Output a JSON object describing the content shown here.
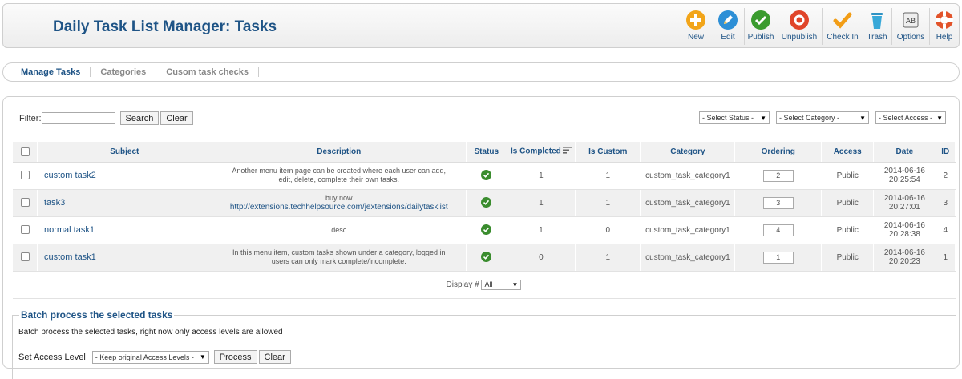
{
  "header": {
    "title": "Daily Task List Manager: Tasks",
    "toolbar": [
      {
        "label": "New",
        "icon": "plus-icon",
        "color": "#f2a51a"
      },
      {
        "label": "Edit",
        "icon": "pencil-icon",
        "color": "#2d8fd6"
      },
      {
        "label": "Publish",
        "icon": "check-icon",
        "color": "#3a9b2e"
      },
      {
        "label": "Unpublish",
        "icon": "circle-icon",
        "color": "#e0452a"
      },
      {
        "label": "Check In",
        "icon": "checkmark-icon",
        "color": "#f29d16"
      },
      {
        "label": "Trash",
        "icon": "trash-icon",
        "color": "#38a8d8"
      },
      {
        "label": "Options",
        "icon": "options-icon",
        "color": "#666666"
      },
      {
        "label": "Help",
        "icon": "lifebuoy-icon",
        "color": "#e2532a"
      }
    ]
  },
  "submenu": {
    "items": [
      "Manage Tasks",
      "Categories",
      "Cusom task checks"
    ],
    "active": 0
  },
  "filter": {
    "label": "Filter:",
    "value": "",
    "search_label": "Search",
    "clear_label": "Clear",
    "status_select": "- Select Status -",
    "category_select": "- Select Category -",
    "access_select": "- Select Access -"
  },
  "table": {
    "columns": [
      "Subject",
      "Description",
      "Status",
      "Is Completed",
      "Is Custom",
      "Category",
      "Ordering",
      "Access",
      "Date",
      "ID"
    ],
    "rows": [
      {
        "subject": "custom task2",
        "desc1": "Another menu item page can be created where each user can add,",
        "desc2": "edit, delete, complete their own tasks.",
        "completed": "1",
        "custom": "1",
        "category": "custom_task_category1",
        "ordering": "2",
        "access": "Public",
        "date1": "2014-06-16",
        "date2": "20:25:54",
        "id": "2"
      },
      {
        "subject": "task3",
        "desc1": "buy now",
        "desc2": "http://extensions.techhelpsource.com/jextensions/dailytasklist",
        "completed": "1",
        "custom": "1",
        "category": "custom_task_category1",
        "ordering": "3",
        "access": "Public",
        "date1": "2014-06-16",
        "date2": "20:27:01",
        "id": "3"
      },
      {
        "subject": "normal task1",
        "desc1": "desc",
        "desc2": "",
        "completed": "1",
        "custom": "0",
        "category": "custom_task_category1",
        "ordering": "4",
        "access": "Public",
        "date1": "2014-06-16",
        "date2": "20:28:38",
        "id": "4"
      },
      {
        "subject": "custom task1",
        "desc1": "In this menu item, custom tasks shown under a category, logged in",
        "desc2": "users can only mark complete/incomplete.",
        "completed": "0",
        "custom": "1",
        "category": "custom_task_category1",
        "ordering": "1",
        "access": "Public",
        "date1": "2014-06-16",
        "date2": "20:20:23",
        "id": "1"
      }
    ],
    "display_label": "Display #",
    "display_value": "All"
  },
  "batch": {
    "legend": "Batch process the selected tasks",
    "description": "Batch process the selected tasks, right now only access levels are allowed",
    "access_label": "Set Access Level",
    "access_select": "- Keep original Access Levels -",
    "process_label": "Process",
    "clear_label": "Clear"
  }
}
